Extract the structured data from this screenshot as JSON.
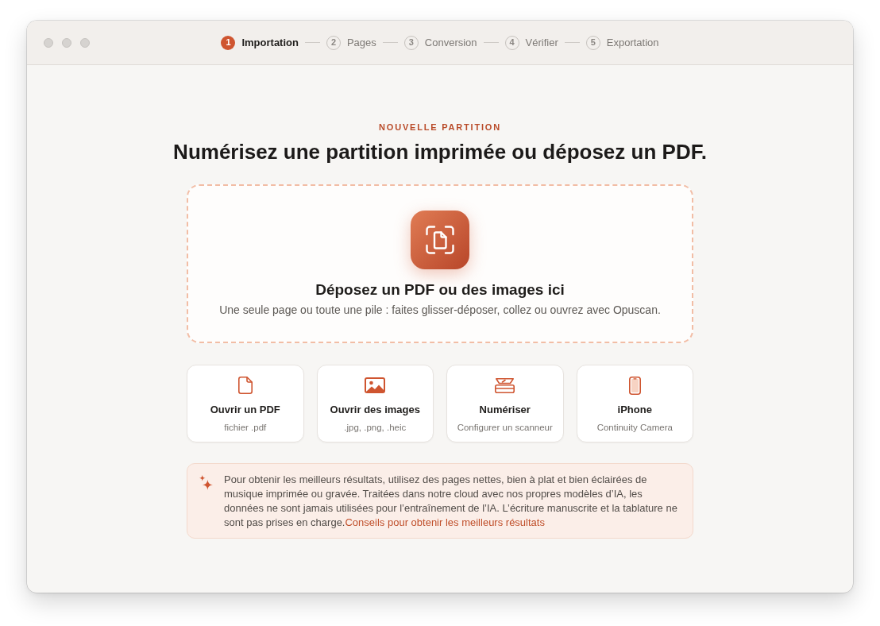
{
  "steps": [
    {
      "number": "1",
      "label": "Importation",
      "selected": true
    },
    {
      "number": "2",
      "label": "Pages",
      "selected": false
    },
    {
      "number": "3",
      "label": "Conversion",
      "selected": false
    },
    {
      "number": "4",
      "label": "Vérifier",
      "selected": false
    },
    {
      "number": "5",
      "label": "Exportation",
      "selected": false
    }
  ],
  "header": {
    "eyebrow": "NOUVELLE PARTITION",
    "title": "Numérisez une partition imprimée ou déposez un PDF."
  },
  "drop_zone": {
    "title": "Déposez un PDF ou des images ici",
    "hint": "Une seule page ou toute une pile : faites glisser-déposer, collez ou ouvrez avec Opuscan."
  },
  "import_options": [
    {
      "kind": "document",
      "title": "Ouvrir un PDF",
      "subtitle": "fichier .pdf"
    },
    {
      "kind": "image",
      "title": "Ouvrir des images",
      "subtitle": ".jpg, .png, .heic"
    },
    {
      "kind": "scanner",
      "title": "Numériser",
      "subtitle": "Configurer un scanneur"
    },
    {
      "kind": "phone",
      "title": "iPhone",
      "subtitle": "Continuity Camera"
    }
  ],
  "notice": {
    "text": "Pour obtenir les meilleurs résultats, utilisez des pages nettes, bien à plat et bien éclairées de musique imprimée ou gravée. Traitées dans notre cloud avec nos propres modèles d’IA, les données ne sont jamais utilisées pour l’entraînement de l’IA. L’écriture manuscrite et la tablature ne sont pas prises en charge.",
    "link": "Conseils pour obtenir les meilleurs résultats"
  }
}
